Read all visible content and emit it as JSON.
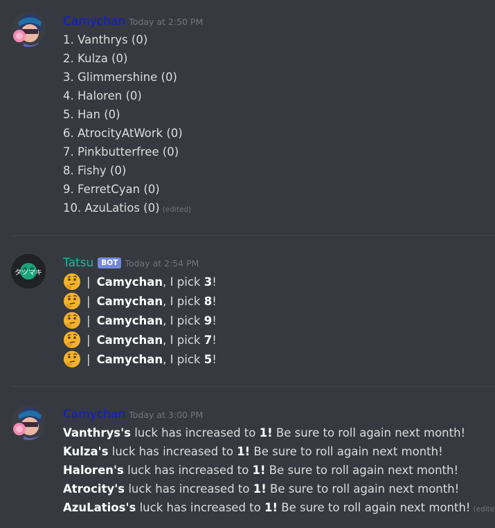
{
  "messages": [
    {
      "author": "Camychan",
      "author_color": "#0f1bd8",
      "timestamp": "Today at 2:50 PM",
      "lines": [
        "1. Vanthrys (0)",
        "2. Kulza (0)",
        "3. Glimmershine (0)",
        "4. Haloren (0)",
        "5. Han (0)",
        "6. AtrocityAtWork (0)",
        "7. Pinkbutterfree (0)",
        "8. Fishy (0)",
        "9. FerretCyan (0)",
        "10. AzuLatios (0)"
      ],
      "edited": "(edited)"
    },
    {
      "author": "Tatsu",
      "author_color": "#1abc9c",
      "badge": "BOT",
      "avatar_text": "タツマキ",
      "timestamp": "Today at 2:54 PM",
      "picks": [
        {
          "emoji": "thinking-face",
          "sep": "|",
          "name": "Camychan",
          "mid": ", I pick ",
          "num": "3",
          "end": "!"
        },
        {
          "emoji": "thinking-face",
          "sep": "|",
          "name": "Camychan",
          "mid": ", I pick ",
          "num": "8",
          "end": "!"
        },
        {
          "emoji": "thinking-face",
          "sep": "|",
          "name": "Camychan",
          "mid": ", I pick ",
          "num": "9",
          "end": "!"
        },
        {
          "emoji": "thinking-face",
          "sep": "|",
          "name": "Camychan",
          "mid": ", I pick ",
          "num": "7",
          "end": "!"
        },
        {
          "emoji": "thinking-face",
          "sep": "|",
          "name": "Camychan",
          "mid": ", I pick ",
          "num": "5",
          "end": "!"
        }
      ]
    },
    {
      "author": "Camychan",
      "author_color": "#0f1bd8",
      "timestamp": "Today at 3:00 PM",
      "luck": [
        {
          "name": "Vanthrys's",
          "mid": " luck has increased to ",
          "num": "1!",
          "end": " Be sure to roll again next month!"
        },
        {
          "name": "Kulza's",
          "mid": " luck has increased to ",
          "num": "1!",
          "end": " Be sure to roll again next month!"
        },
        {
          "name": "Haloren's",
          "mid": " luck has increased to ",
          "num": "1!",
          "end": " Be sure to roll again next month!"
        },
        {
          "name": "Atrocity's",
          "mid": " luck has increased to ",
          "num": "1!",
          "end": " Be sure to roll again next month!"
        },
        {
          "name": "AzuLatios's",
          "mid": " luck has increased to ",
          "num": "1!",
          "end": " Be sure to roll again next month!"
        }
      ],
      "edited": "(edited)"
    }
  ]
}
